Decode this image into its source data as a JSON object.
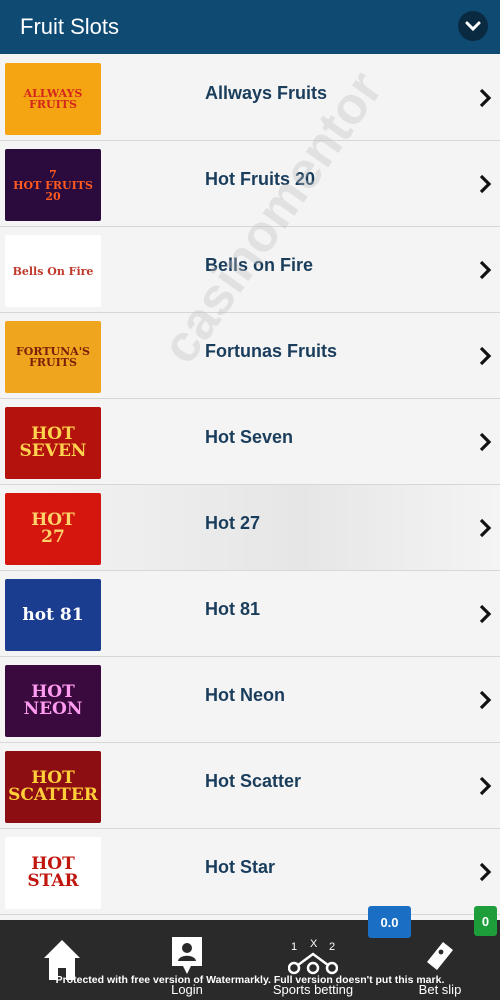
{
  "header": {
    "title": "Fruit Slots"
  },
  "games": [
    {
      "label": "Allways Fruits",
      "thumb_text": "ALLWAYS\nFRUITS",
      "thumb_bg": "#f5a512",
      "thumb_fg": "#d4261c"
    },
    {
      "label": "Hot Fruits 20",
      "thumb_text": "7\nHOT FRUITS 20",
      "thumb_bg": "#2b0a3d",
      "thumb_fg": "#ff5a1f"
    },
    {
      "label": "Bells on Fire",
      "thumb_text": "Bells On Fire",
      "thumb_bg": "#ffffff",
      "thumb_fg": "#c0392b"
    },
    {
      "label": "Fortunas Fruits",
      "thumb_text": "FORTUNA'S\nFRUITS",
      "thumb_bg": "#f0a51e",
      "thumb_fg": "#7a1f0a"
    },
    {
      "label": "Hot Seven",
      "thumb_text": "HOT\nSEVEN",
      "thumb_bg": "#b3120d",
      "thumb_fg": "#ffd34d"
    },
    {
      "label": "Hot 27",
      "thumb_text": "HOT\n27",
      "thumb_bg": "#d4160e",
      "thumb_fg": "#ffd36a"
    },
    {
      "label": "Hot 81",
      "thumb_text": "hot 81",
      "thumb_bg": "#1a3d8f",
      "thumb_fg": "#ffffff"
    },
    {
      "label": "Hot Neon",
      "thumb_text": "HOT\nNEON",
      "thumb_bg": "#3a0a3e",
      "thumb_fg": "#ff9bf0"
    },
    {
      "label": "Hot Scatter",
      "thumb_text": "HOT\nSCATTER",
      "thumb_bg": "#8c0d12",
      "thumb_fg": "#ffcf3a"
    },
    {
      "label": "Hot Star",
      "thumb_text": "HOT STAR",
      "thumb_bg": "#ffffff",
      "thumb_fg": "#c0160e"
    }
  ],
  "bottom_nav": {
    "login": "Login",
    "sports": "Sports betting",
    "betslip": "Bet slip",
    "balance": "0.0",
    "betslip_count": "0"
  },
  "watermark": {
    "logo": "casinomentor",
    "note": "Protected with free version of Watermarkly. Full version doesn't put this mark."
  },
  "colors": {
    "header": "#0f4a73",
    "balance_badge": "#1a6fc4",
    "count_badge": "#1e9e3a"
  }
}
